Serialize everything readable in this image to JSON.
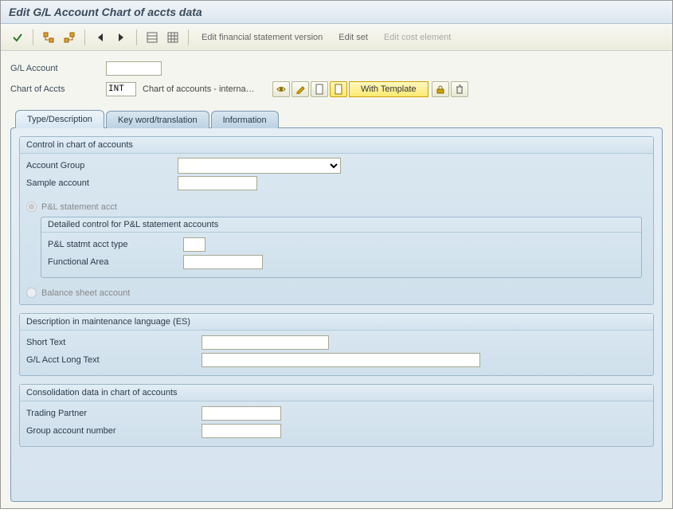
{
  "title": "Edit G/L Account Chart of accts data",
  "toolbar": {
    "edit_fin_stmt": "Edit financial statement version",
    "edit_set": "Edit set",
    "edit_cost_element": "Edit cost element"
  },
  "header": {
    "gl_account_label": "G/L Account",
    "gl_account_value": "",
    "chart_of_accts_label": "Chart of Accts",
    "chart_of_accts_value": "INT",
    "chart_of_accts_desc": "Chart of accounts - interna…",
    "with_template_label": "With Template"
  },
  "tabs": {
    "type_desc": "Type/Description",
    "keyword": "Key word/translation",
    "information": "Information"
  },
  "group_control": {
    "title": "Control in chart of accounts",
    "account_group_label": "Account Group",
    "sample_account_label": "Sample account",
    "pl_radio": "P&L statement acct",
    "detailed_title": "Detailed control for P&L statement accounts",
    "pl_type_label": "P&L statmt acct type",
    "func_area_label": "Functional Area",
    "bs_radio": "Balance sheet account"
  },
  "group_desc": {
    "title": "Description in maintenance language (ES)",
    "short_text_label": "Short Text",
    "long_text_label": "G/L Acct Long Text"
  },
  "group_consol": {
    "title": "Consolidation data in chart of accounts",
    "trading_partner_label": "Trading Partner",
    "group_account_label": "Group account number"
  }
}
